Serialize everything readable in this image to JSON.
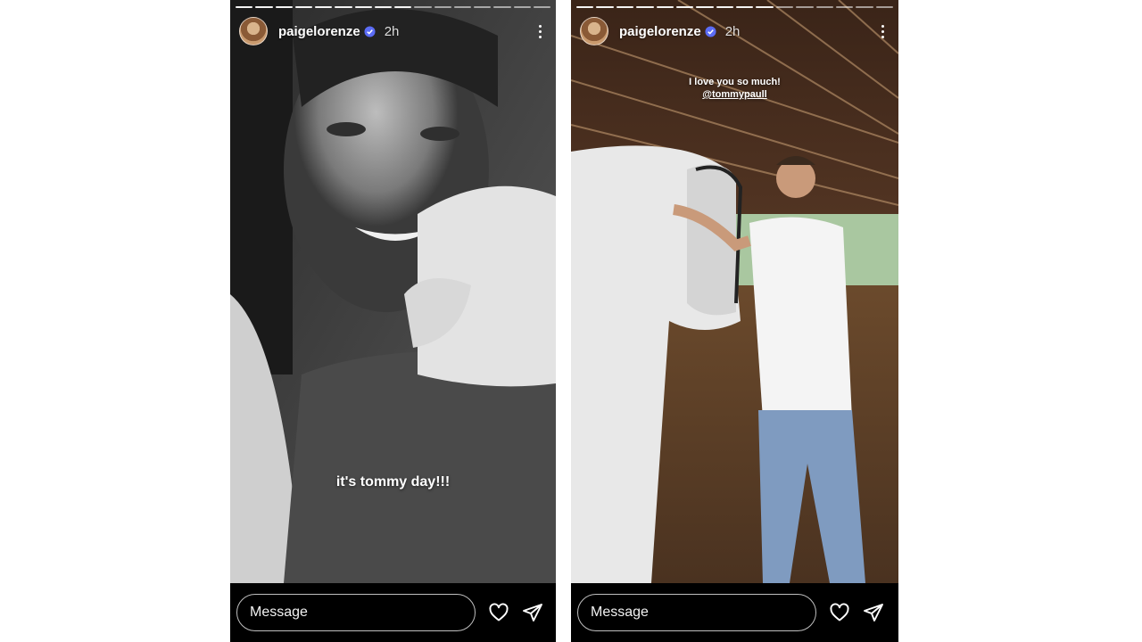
{
  "stories": [
    {
      "username": "paigelorenze",
      "timestamp": "2h",
      "caption": "it's tommy day!!!",
      "message_placeholder": "Message"
    },
    {
      "username": "paigelorenze",
      "timestamp": "2h",
      "caption_line1": "I love you so much!",
      "caption_mention": "@tommypaull",
      "message_placeholder": "Message"
    }
  ],
  "icons": {
    "avatar": "avatar",
    "verified": "verified-badge-icon",
    "more": "more-options-icon",
    "like": "heart-icon",
    "share": "send-icon"
  },
  "colors": {
    "verified_badge": "#5b6cf5",
    "footer_bg": "#000000"
  }
}
